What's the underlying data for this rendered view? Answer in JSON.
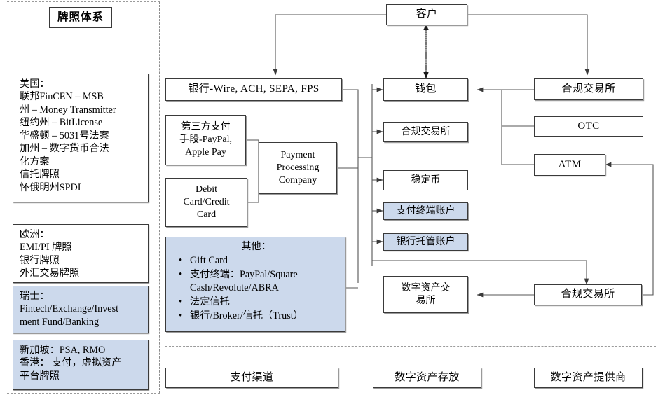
{
  "diagram": {
    "title_box": "牌照体系",
    "license_boxes": [
      {
        "id": "us",
        "text": "美国：\n联邦FinCEN – MSB\n州 – Money Transmitter\n纽约州 – BitLicense\n华盛顿 – 5031号法案\n加州 – 数字货币合法\n化方案\n信托牌照\n怀俄明州SPDI",
        "style": "white"
      },
      {
        "id": "europe",
        "text": "欧洲：\nEMI/PI 牌照\n银行牌照\n外汇交易牌照",
        "style": "white"
      },
      {
        "id": "switzerland",
        "text": "瑞士：\nFintech/Exchange/Invest\nment Fund/Banking",
        "style": "blue"
      },
      {
        "id": "singapore-hk",
        "text": "新加坡：PSA, RMO\n香港： 支付，虚拟资产\n平台牌照",
        "style": "blue"
      }
    ],
    "nodes": {
      "customer": "客户",
      "bank": "银行-Wire, ACH, SEPA, FPS",
      "third_party_pay": "第三方支付\n手段-PayPal,\nApple Pay",
      "debit_credit": "Debit\nCard/Credit\nCard",
      "payment_processing": "Payment\nProcessing\nCompany",
      "wallet": "钱包",
      "compliant_exchange_mid": "合规交易所",
      "stablecoin": "稳定币",
      "payment_terminal_account": "支付终端账户",
      "bank_custody_account": "银行托管账户",
      "digital_asset_exchange": "数字资产交\n易所",
      "compliant_exchange_top_right": "合规交易所",
      "otc": "OTC",
      "atm": "ATM",
      "compliant_exchange_bottom_right": "合规交易所"
    },
    "other_box": {
      "header": "其他：",
      "items": [
        "Gift Card",
        "支付终端：PayPal/Square\nCash/Revolute/ABRA",
        "法定信托",
        "银行/Broker/信托（Trust）"
      ]
    },
    "footer_boxes": [
      "支付渠道",
      "数字资产存放",
      "数字资产提供商"
    ],
    "colors": {
      "highlight_fill": "#ccd9ec",
      "border": "#3a3a3a",
      "connector": "#555555",
      "divider": "#8c8c8c"
    }
  }
}
